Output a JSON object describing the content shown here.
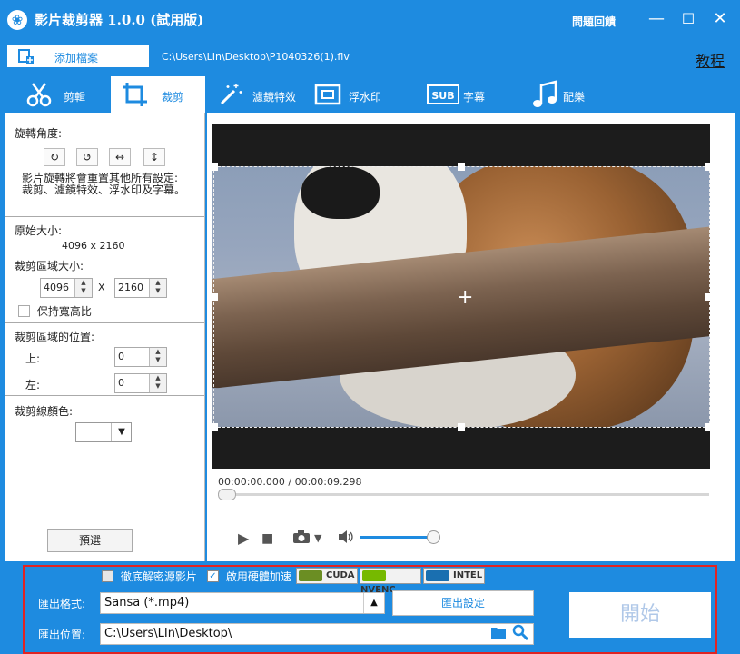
{
  "app": {
    "title": "影片裁剪器 1.0.0 (試用版)",
    "feedback": "問題回饋",
    "min_symbol": "—",
    "max_symbol": "☐",
    "close_symbol": "✕"
  },
  "filebar": {
    "add_file_label": "添加檔案",
    "file_path": "C:\\Users\\LIn\\Desktop\\P1040326(1).flv",
    "tutorial": "教程"
  },
  "tabs": [
    {
      "label": "剪輯",
      "icon": "scissors-icon"
    },
    {
      "label": "裁剪",
      "icon": "crop-icon"
    },
    {
      "label": "濾鏡特效",
      "icon": "magic-wand-icon"
    },
    {
      "label": "浮水印",
      "icon": "watermark-icon"
    },
    {
      "label": "字幕",
      "icon": "subtitle-icon"
    },
    {
      "label": "配樂",
      "icon": "music-icon"
    }
  ],
  "left_panel": {
    "rotate_label": "旋轉角度:",
    "rotate_note": "影片旋轉將會重置其他所有設定: 裁剪、濾鏡特效、浮水印及字幕。",
    "original_size_label": "原始大小:",
    "original_size_value": "4096 x 2160",
    "crop_size_label": "裁剪區域大小:",
    "crop_width": "4096",
    "crop_height": "2160",
    "x_separator": "X",
    "keep_ratio_label": "保持寬高比",
    "crop_position_label": "裁剪區域的位置:",
    "top_label": "上:",
    "top_value": "0",
    "left_label": "左:",
    "left_value": "0",
    "line_color_label": "裁剪線顏色:",
    "line_color": "#ffffff",
    "preset_button": "預選"
  },
  "player": {
    "timecode": "00:00:00.000 / 00:00:09.298",
    "seek_progress": 0.0,
    "volume_level": 0.85
  },
  "export": {
    "deinterlace_label": "徹底解密源影片",
    "hw_accel_label": "啟用硬體加速",
    "hw_badges": [
      "CUDA",
      "NVENC",
      "INTEL"
    ],
    "format_label": "匯出格式:",
    "format_value": "Sansa (*.mp4)",
    "settings_button": "匯出設定",
    "location_label": "匯出位置:",
    "location_value": "C:\\Users\\LIn\\Desktop\\",
    "start_button": "開始"
  },
  "colors": {
    "accent": "#1e8be0",
    "highlight_border": "#e02424"
  }
}
